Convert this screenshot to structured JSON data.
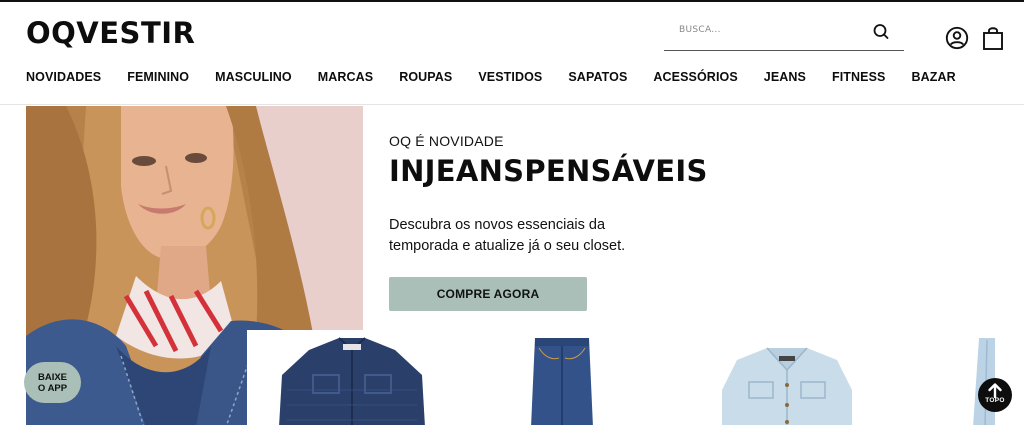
{
  "header": {
    "logo": "OQVESTIR",
    "search": {
      "placeholder": "BUSCA...",
      "icon": "search-icon"
    },
    "user_icon": "user-icon",
    "bag_icon": "shopping-bag-icon"
  },
  "nav": {
    "items": [
      {
        "label": "NOVIDADES"
      },
      {
        "label": "FEMININO"
      },
      {
        "label": "MASCULINO"
      },
      {
        "label": "MARCAS"
      },
      {
        "label": "ROUPAS"
      },
      {
        "label": "VESTIDOS"
      },
      {
        "label": "SAPATOS"
      },
      {
        "label": "ACESSÓRIOS"
      },
      {
        "label": "JEANS"
      },
      {
        "label": "FITNESS"
      },
      {
        "label": "BAZAR"
      }
    ]
  },
  "promo": {
    "kicker": "OQ É NOVIDADE",
    "title": "INJEANSPENSÁVEIS",
    "description": "Descubra os novos essenciais da temporada e atualize já o seu closet.",
    "cta_label": "COMPRE AGORA",
    "cta_color": "#a9bfb7"
  },
  "floating": {
    "app_badge_line1": "BAIXE",
    "app_badge_line2": "O APP",
    "top_label": "TOPO",
    "top_icon": "arrow-up-icon"
  },
  "colors": {
    "accent": "#a9bfb7",
    "text": "#0d0d0d",
    "hero_bg": "#ecd9d6",
    "denim_dark": "#2a3f6a",
    "denim_mid": "#3c5a8e",
    "denim_light": "#c9dcea"
  }
}
